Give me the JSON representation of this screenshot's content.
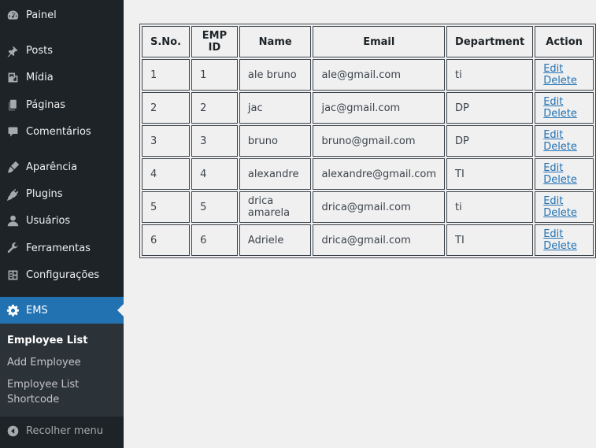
{
  "sidebar": {
    "items": [
      {
        "label": "Painel",
        "icon": "dashboard-icon"
      },
      {
        "label": "Posts",
        "icon": "pin-icon"
      },
      {
        "label": "Mídia",
        "icon": "media-icon"
      },
      {
        "label": "Páginas",
        "icon": "pages-icon"
      },
      {
        "label": "Comentários",
        "icon": "comments-icon"
      },
      {
        "label": "Aparência",
        "icon": "brush-icon"
      },
      {
        "label": "Plugins",
        "icon": "plugin-icon"
      },
      {
        "label": "Usuários",
        "icon": "users-icon"
      },
      {
        "label": "Ferramentas",
        "icon": "wrench-icon"
      },
      {
        "label": "Configurações",
        "icon": "settings-icon"
      },
      {
        "label": "EMS",
        "icon": "gear-icon",
        "active": true
      }
    ],
    "submenu": [
      {
        "label": "Employee List",
        "current": true
      },
      {
        "label": "Add Employee"
      },
      {
        "label": "Employee List Shortcode"
      }
    ],
    "collapse_label": "Recolher menu"
  },
  "table": {
    "headers": [
      "S.No.",
      "EMP ID",
      "Name",
      "Email",
      "Department",
      "Action"
    ],
    "rows": [
      {
        "sno": "1",
        "emp_id": "1",
        "name": "ale bruno",
        "email": "ale@gmail.com",
        "department": "ti"
      },
      {
        "sno": "2",
        "emp_id": "2",
        "name": "jac",
        "email": "jac@gmail.com",
        "department": "DP"
      },
      {
        "sno": "3",
        "emp_id": "3",
        "name": "bruno",
        "email": "bruno@gmail.com",
        "department": "DP"
      },
      {
        "sno": "4",
        "emp_id": "4",
        "name": "alexandre",
        "email": "alexandre@gmail.com",
        "department": "TI"
      },
      {
        "sno": "5",
        "emp_id": "5",
        "name": "drica amarela",
        "email": "drica@gmail.com",
        "department": "ti"
      },
      {
        "sno": "6",
        "emp_id": "6",
        "name": "Adriele",
        "email": "drica@gmail.com",
        "department": "TI"
      }
    ],
    "edit_label": "Edit",
    "delete_label": "Delete"
  },
  "colors": {
    "sidebar_bg": "#1d2327",
    "submenu_bg": "#2c3338",
    "accent": "#2271b1",
    "page_bg": "#f0f0f1"
  }
}
